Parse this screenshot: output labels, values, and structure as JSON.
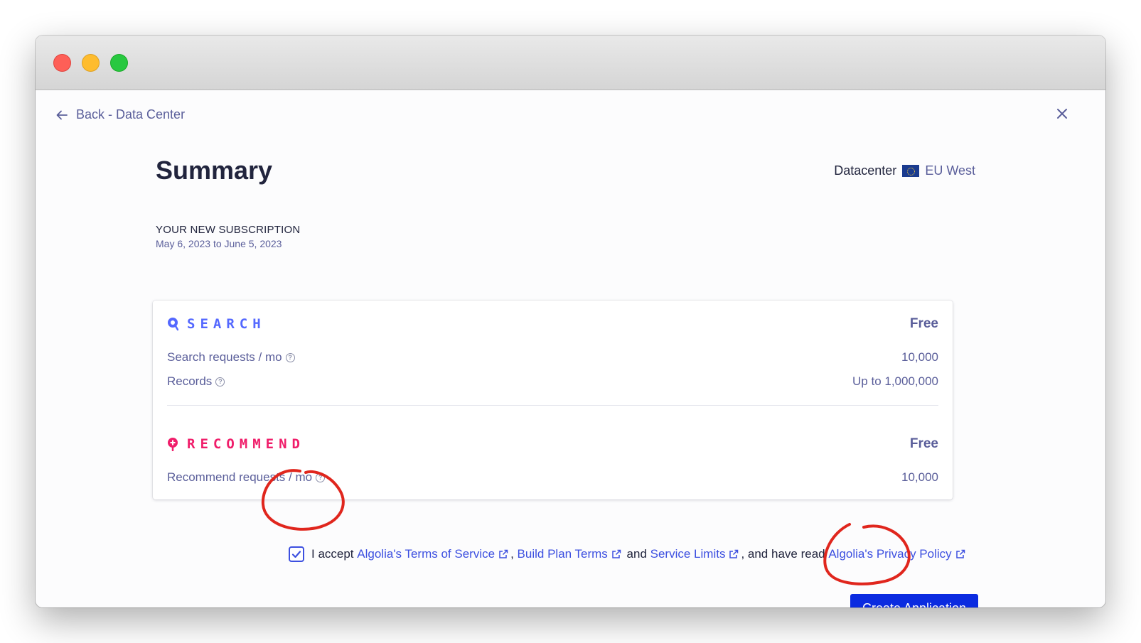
{
  "nav": {
    "back_label": "Back - Data Center"
  },
  "page": {
    "title": "Summary",
    "datacenter_label": "Datacenter",
    "datacenter_region": "EU West"
  },
  "subscription": {
    "heading": "YOUR NEW SUBSCRIPTION",
    "dates": "May 6, 2023 to June 5, 2023"
  },
  "plans": {
    "search": {
      "name": "SEARCH",
      "price": "Free",
      "rows": [
        {
          "label": "Search requests / mo",
          "value": "10,000"
        },
        {
          "label": "Records",
          "value": "Up to 1,000,000"
        }
      ]
    },
    "recommend": {
      "name": "RECOMMEND",
      "price": "Free",
      "rows": [
        {
          "label": "Recommend requests / mo",
          "value": "10,000"
        }
      ]
    }
  },
  "terms": {
    "checked": true,
    "prefix": "I accept",
    "link_tos": "Algolia's Terms of Service",
    "sep1": ",",
    "link_build": "Build Plan Terms",
    "and": "and",
    "link_limits": "Service Limits",
    "middle": ", and have read",
    "link_privacy": "Algolia's Privacy Policy"
  },
  "actions": {
    "create_label": "Create Application"
  },
  "colors": {
    "search_accent": "#5468ff",
    "recommend_accent": "#f01d6a",
    "primary_button": "#0b2be0",
    "annotation": "#e0261d"
  },
  "icons": {
    "back": "arrow-left-icon",
    "close": "close-icon",
    "help": "question-circle-icon",
    "external": "external-link-icon",
    "flag": "eu-flag-icon",
    "search_logo": "search-pin-icon",
    "recommend_logo": "recommend-pin-icon"
  }
}
